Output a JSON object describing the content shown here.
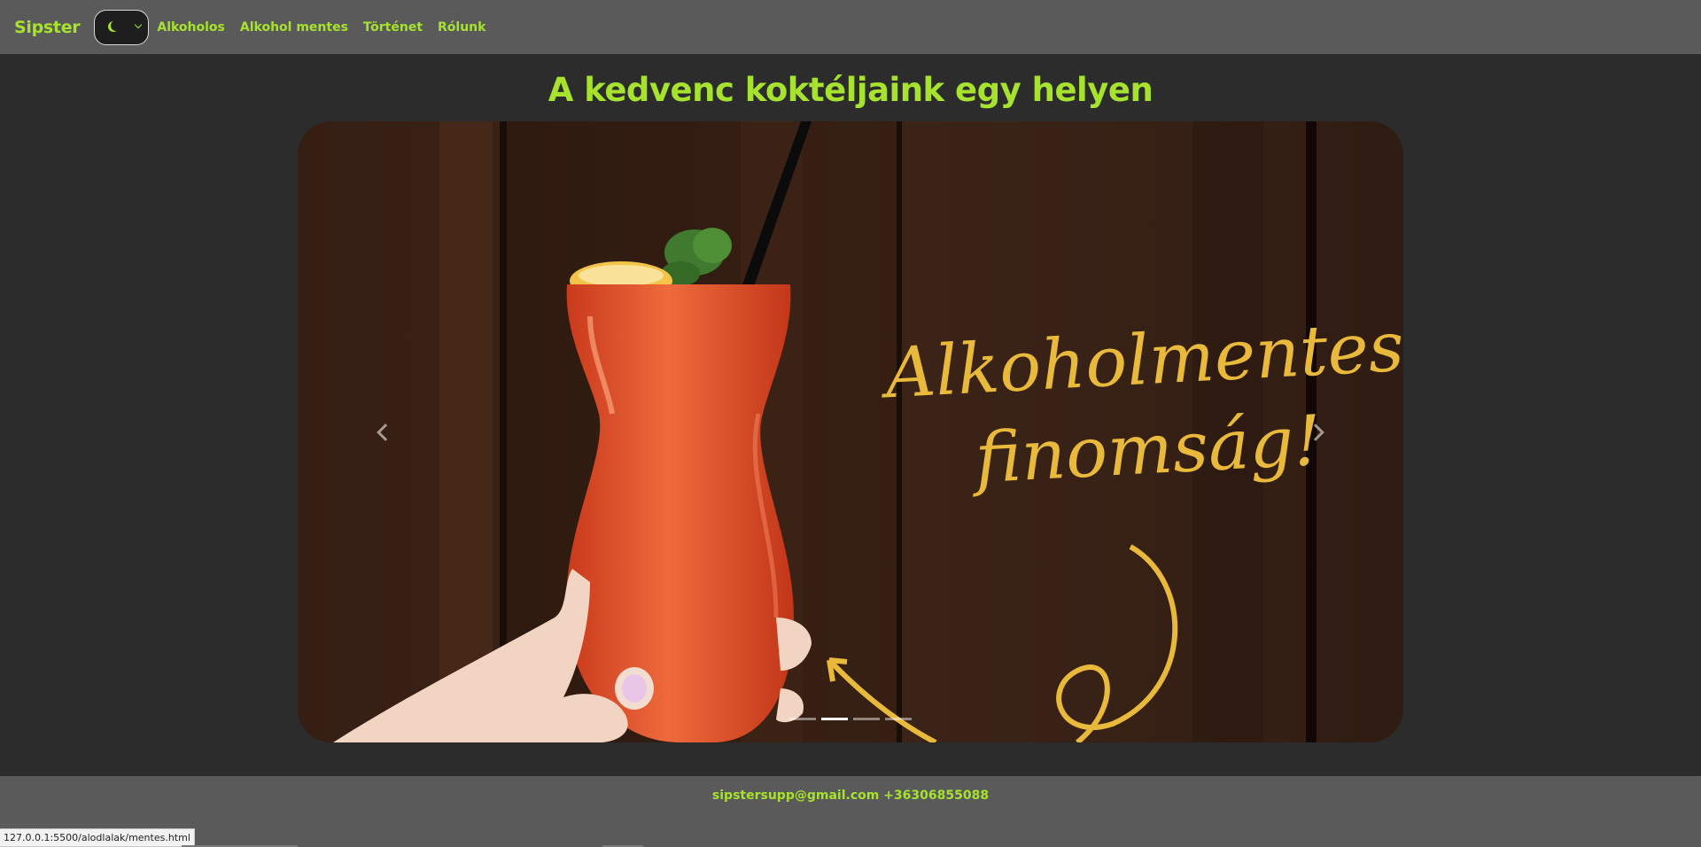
{
  "navbar": {
    "brand": "Sipster",
    "theme_icon": "moon-icon",
    "links": [
      "Alkoholos",
      "Alkohol mentes",
      "Történet",
      "Rólunk"
    ]
  },
  "hero": {
    "title": "A kedvenc koktéljaink egy helyen"
  },
  "carousel": {
    "slide_text": [
      "Alkoholmentes",
      "finomság!"
    ],
    "slide_count": 4,
    "active_index": 1,
    "prev_icon": "chevron-left-icon",
    "next_icon": "chevron-right-icon"
  },
  "footer": {
    "contact": "sipstersupp@gmail.com +36306855088"
  },
  "status_bar": {
    "url": "127.0.0.1:5500/alodlalak/mentes.html"
  },
  "colors": {
    "accent": "#a6e22e",
    "navbar_bg": "#5a5a5a",
    "page_bg": "#2c2c2c",
    "slide_text": "#e8b93a",
    "drink": "#e8532a"
  }
}
